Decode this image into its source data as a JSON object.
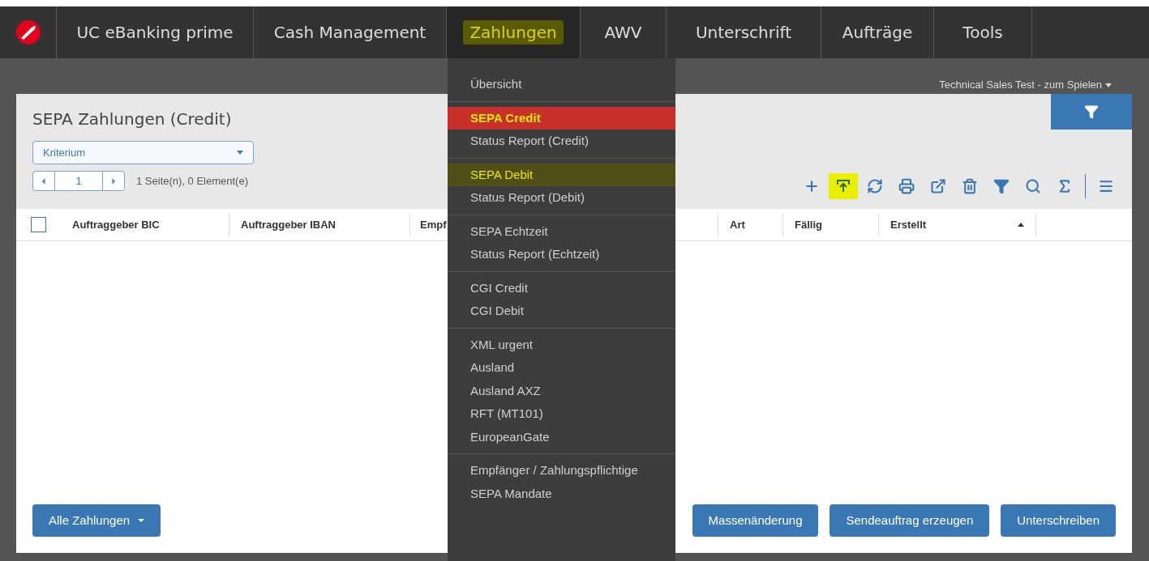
{
  "nav": {
    "tabs": [
      {
        "label": "UC eBanking prime",
        "selected": false,
        "highlighted": false
      },
      {
        "label": "Cash Management",
        "selected": false,
        "highlighted": false
      },
      {
        "label": "Zahlungen",
        "selected": true,
        "highlighted": true
      },
      {
        "label": "AWV",
        "selected": false,
        "highlighted": false
      },
      {
        "label": "Unterschrift",
        "selected": false,
        "highlighted": false
      },
      {
        "label": "Aufträge",
        "selected": false,
        "highlighted": false
      },
      {
        "label": "Tools",
        "selected": false,
        "highlighted": false
      }
    ]
  },
  "account": {
    "label": "Technical Sales Test - zum Spielen"
  },
  "card": {
    "title": "SEPA Zahlungen (Credit)",
    "criterion": {
      "placeholder": "Kriterium"
    },
    "pager": {
      "page": "1",
      "info": "1 Seite(n), 0 Element(e)"
    },
    "toolbar": [
      {
        "kind": "add",
        "highlighted": false
      },
      {
        "kind": "upload",
        "highlighted": true
      },
      {
        "kind": "refresh",
        "highlighted": false
      },
      {
        "kind": "print",
        "highlighted": false
      },
      {
        "kind": "export",
        "highlighted": false
      },
      {
        "kind": "delete",
        "highlighted": false
      },
      {
        "kind": "filter",
        "highlighted": false
      },
      {
        "kind": "search",
        "highlighted": false
      },
      {
        "kind": "sum",
        "highlighted": false
      },
      {
        "kind": "menu",
        "highlighted": false
      }
    ],
    "table": {
      "select_all": {
        "checked": false
      },
      "columns": [
        {
          "label": "Auftraggeber BIC"
        },
        {
          "label": "Auftraggeber IBAN"
        },
        {
          "label": "Empf"
        },
        {
          "label": "Art"
        },
        {
          "label": "Fällig"
        },
        {
          "label": "Erstellt",
          "sorted": true
        }
      ]
    },
    "buttons": {
      "left": "Alle Zahlungen",
      "right": [
        "Massenänderung",
        "Sendeauftrag erzeugen",
        "Unterschreiben"
      ]
    }
  },
  "menu": {
    "groups": [
      {
        "items": [
          {
            "label": "Übersicht",
            "selected": false,
            "highlighted": false
          }
        ]
      },
      {
        "items": [
          {
            "label": "SEPA Credit",
            "selected": true,
            "highlighted": true
          },
          {
            "label": "Status Report (Credit)",
            "selected": false,
            "highlighted": false
          }
        ]
      },
      {
        "items": [
          {
            "label": "SEPA Debit",
            "selected": false,
            "highlighted": true
          },
          {
            "label": "Status Report (Debit)",
            "selected": false,
            "highlighted": false
          }
        ]
      },
      {
        "items": [
          {
            "label": "SEPA Echtzeit",
            "selected": false,
            "highlighted": false
          },
          {
            "label": "Status Report (Echtzeit)",
            "selected": false,
            "highlighted": false
          }
        ]
      },
      {
        "items": [
          {
            "label": "CGI Credit",
            "selected": false,
            "highlighted": false
          },
          {
            "label": "CGI Debit",
            "selected": false,
            "highlighted": false
          }
        ]
      },
      {
        "items": [
          {
            "label": "XML urgent",
            "selected": false,
            "highlighted": false
          },
          {
            "label": "Ausland",
            "selected": false,
            "highlighted": false
          },
          {
            "label": "Ausland AXZ",
            "selected": false,
            "highlighted": false
          },
          {
            "label": "RFT (MT101)",
            "selected": false,
            "highlighted": false
          },
          {
            "label": "EuropeanGate",
            "selected": false,
            "highlighted": false
          }
        ]
      },
      {
        "items": [
          {
            "label": "Empfänger / Zahlungspflichtige",
            "selected": false,
            "highlighted": false
          },
          {
            "label": "SEPA Mandate",
            "selected": false,
            "highlighted": false
          }
        ]
      }
    ]
  }
}
